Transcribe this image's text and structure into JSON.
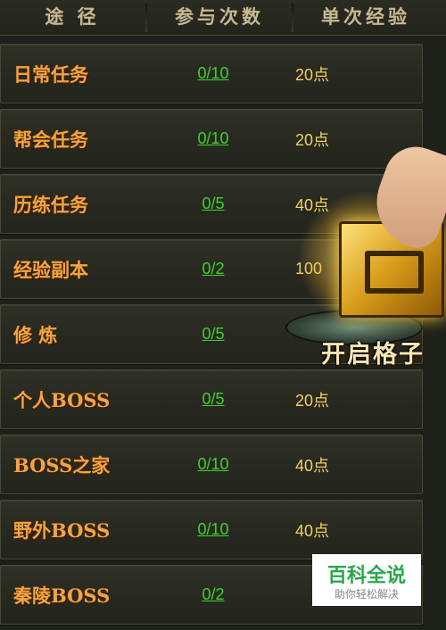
{
  "header": {
    "col_route": "途 径",
    "col_times": "参与次数",
    "col_exp": "单次经验"
  },
  "rows": [
    {
      "name": "日常任务",
      "count": "0/10",
      "exp": "20点"
    },
    {
      "name": "帮会任务",
      "count": "0/10",
      "exp": "20点"
    },
    {
      "name": "历练任务",
      "count": "0/5",
      "exp": "40点"
    },
    {
      "name": "经验副本",
      "count": "0/2",
      "exp": "100"
    },
    {
      "name": "修 炼",
      "count": "0/5",
      "exp": ""
    },
    {
      "name": "个人BOSS",
      "count": "0/5",
      "exp": "20点"
    },
    {
      "name": "BOSS之家",
      "count": "0/10",
      "exp": "40点"
    },
    {
      "name": "野外BOSS",
      "count": "0/10",
      "exp": "40点"
    },
    {
      "name": "秦陵BOSS",
      "count": "0/2",
      "exp": ""
    }
  ],
  "promo": {
    "text": "开启格子",
    "icon": "treasure-chest-icon"
  },
  "watermark": {
    "title": "百科全说",
    "subtitle": "助你轻松解决"
  },
  "colors": {
    "background": "#1e201a",
    "row_name": "#f0a444",
    "count_link": "#3fd12a",
    "exp_value": "#f0d060",
    "header_text": "#c8b890"
  }
}
